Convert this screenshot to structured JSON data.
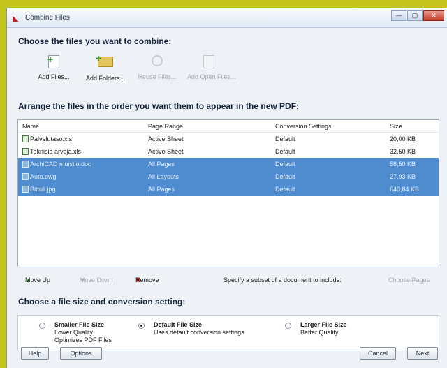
{
  "window": {
    "title": "Combine Files",
    "controls": [
      "—",
      "▢",
      "✕"
    ]
  },
  "section1": {
    "heading": "Choose the files you want to combine:"
  },
  "toolbar": {
    "add_files": "Add Files...",
    "add_folders": "Add Folders...",
    "reuse_files": "Reuse Files...",
    "add_open_files": "Add Open Files..."
  },
  "section2": {
    "heading": "Arrange the files in the order you want them to appear in the new PDF:"
  },
  "list": {
    "headers": [
      "Name",
      "Page Range",
      "Conversion Settings",
      "Size"
    ],
    "rows": [
      {
        "name": "Palvelutaso.xls",
        "range": "Active Sheet",
        "conversion": "Default",
        "size": "20,00 KB",
        "selected": false
      },
      {
        "name": "Teknisia arvoja.xls",
        "range": "Active Sheet",
        "conversion": "Default",
        "size": "32,50 KB",
        "selected": false
      },
      {
        "name": "ArchiCAD muistio.doc",
        "range": "All Pages",
        "conversion": "Default",
        "size": "58,50 KB",
        "selected": true
      },
      {
        "name": "Auto.dwg",
        "range": "All Layouts",
        "conversion": "Default",
        "size": "27,93 KB",
        "selected": true
      },
      {
        "name": "Bittuli.jpg",
        "range": "All Pages",
        "conversion": "Default",
        "size": "640,84 KB",
        "selected": true
      }
    ]
  },
  "list_tools": {
    "move_up": "Move Up",
    "move_down": "Move Down",
    "remove": "Remove",
    "subset_hint": "Specify a subset of a document to include:",
    "choose_pages": "Choose Pages"
  },
  "section3": {
    "heading": "Choose a file size and conversion setting:"
  },
  "options": [
    {
      "title": "Smaller File Size",
      "lines": [
        "Lower Quality",
        "Optimizes PDF Files"
      ],
      "selected": false
    },
    {
      "title": "Default File Size",
      "lines": [
        "Uses default conversion settings"
      ],
      "selected": true
    },
    {
      "title": "Larger File Size",
      "lines": [
        "Better Quality"
      ],
      "selected": false
    }
  ],
  "buttons": {
    "help": "Help",
    "options": "Options",
    "cancel": "Cancel",
    "next": "Next"
  }
}
